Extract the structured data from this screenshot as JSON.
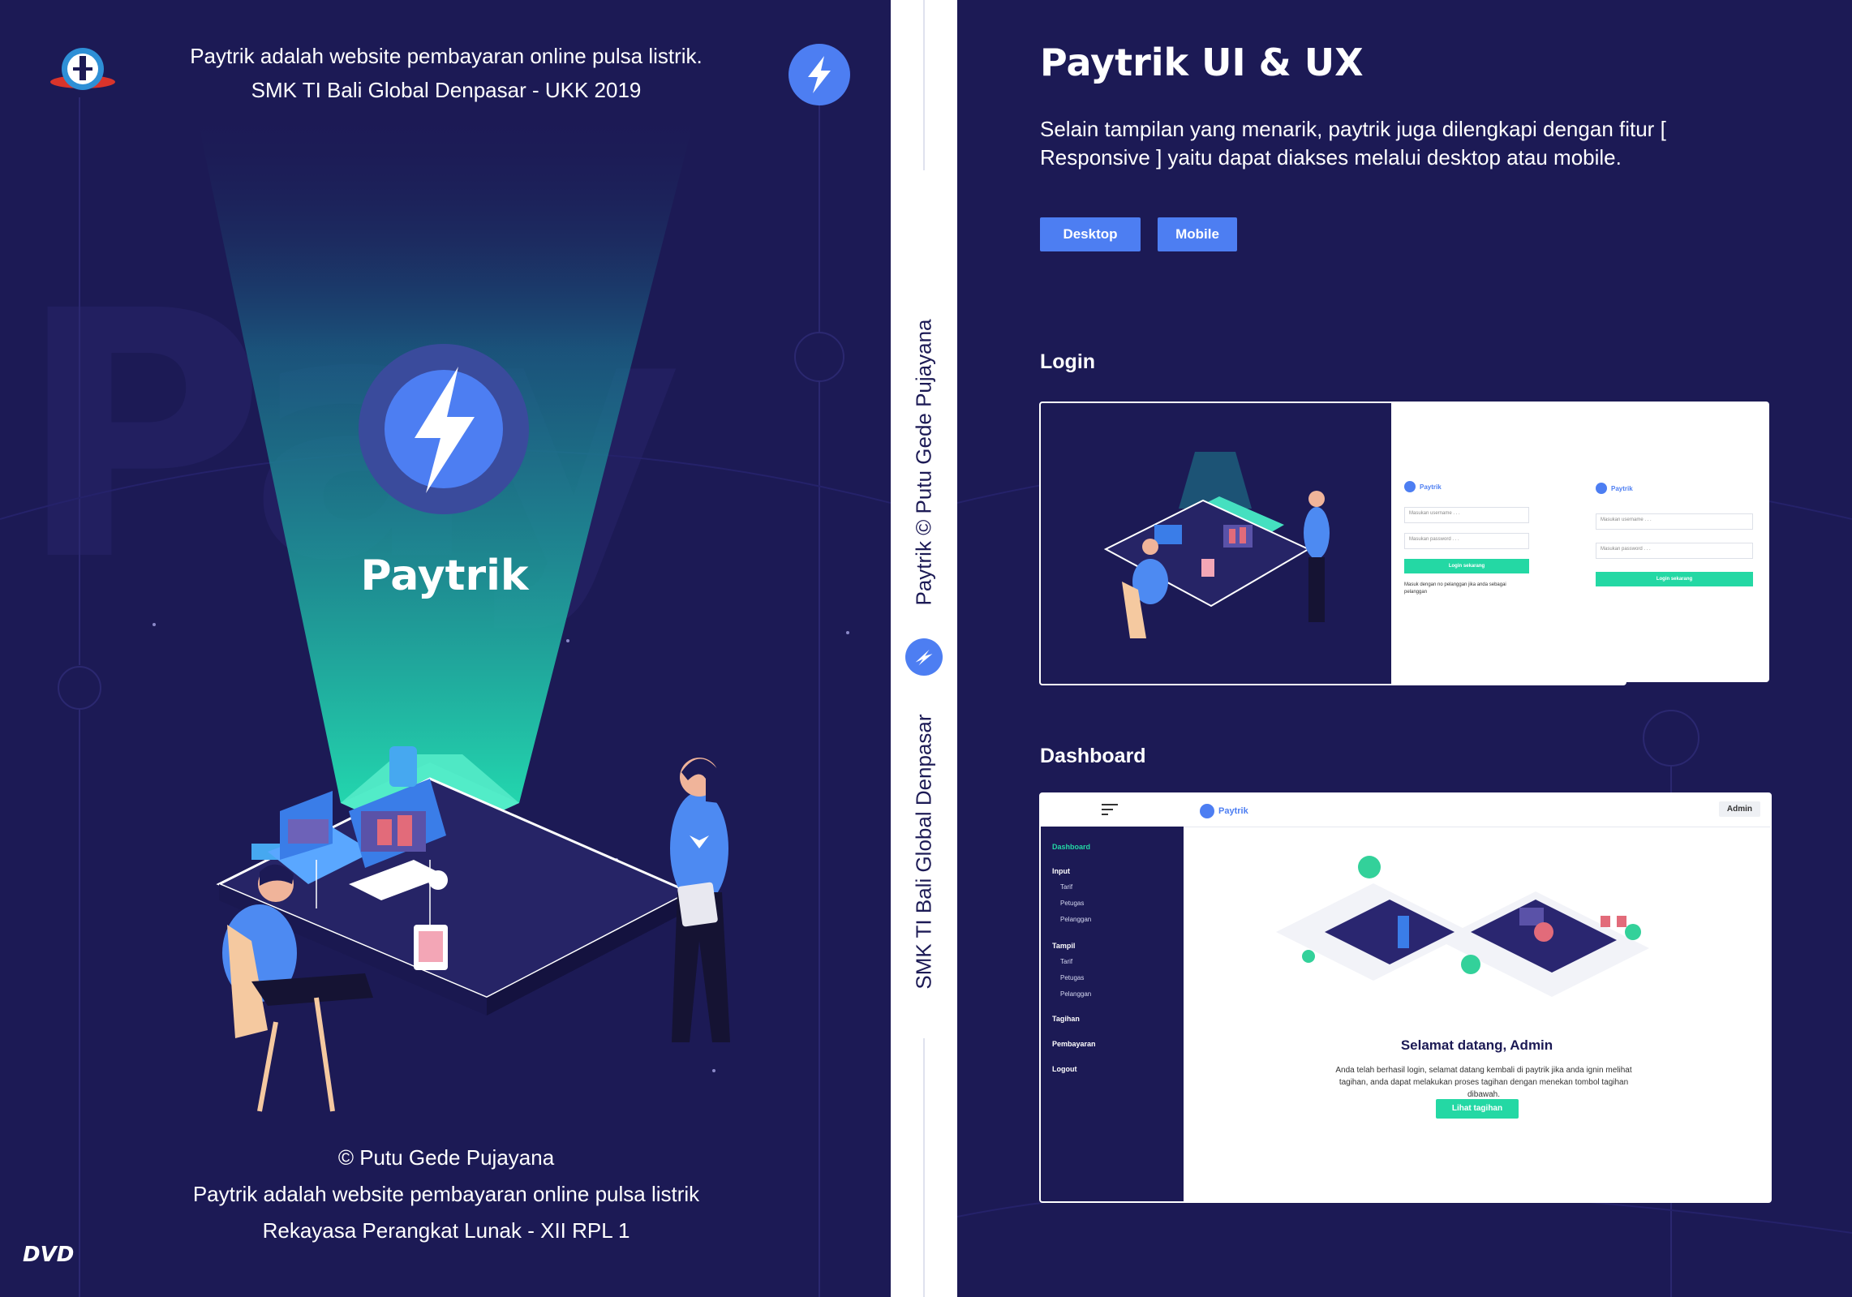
{
  "cover": {
    "top_line1": "Paytrik adalah website pembayaran online pulsa listrik.",
    "top_line2": "SMK TI Bali Global Denpasar - UKK 2019",
    "brand": "Paytrik",
    "bottom_line1": "© Putu Gede Pujayana",
    "bottom_line2": "Paytrik adalah website pembayaran online pulsa listrik",
    "bottom_line3": "Rekayasa Perangkat Lunak - XII RPL 1",
    "dvd_label": "DVD",
    "watermark": "Pay"
  },
  "spine": {
    "top_text": "Paytrik © Putu Gede Pujayana",
    "bottom_text": "SMK TI Bali Global Denpasar"
  },
  "right": {
    "title": "Paytrik UI & UX",
    "description": "Selain tampilan yang menarik, paytrik juga dilengkapi dengan fitur [ Responsive ] yaitu dapat diakses melalui desktop atau mobile.",
    "btn_desktop": "Desktop",
    "btn_mobile": "Mobile",
    "login_heading": "Login",
    "dashboard_heading": "Dashboard"
  },
  "login_preview": {
    "brand": "Paytrik",
    "username_placeholder": "Masukan username . . .",
    "password_placeholder": "Masukan password . . .",
    "login_button": "Login sekarang",
    "note": "Masuk dengan no pelanggan jika anda sebagai pelanggan"
  },
  "dashboard_preview": {
    "brand": "Paytrik",
    "admin": "Admin",
    "menu": {
      "dashboard": "Dashboard",
      "input": "Input",
      "input_items": [
        "Tarif",
        "Petugas",
        "Pelanggan"
      ],
      "tampil": "Tampil",
      "tampil_items": [
        "Tarif",
        "Petugas",
        "Pelanggan"
      ],
      "tagihan": "Tagihan",
      "pembayaran": "Pembayaran",
      "logout": "Logout"
    },
    "welcome": "Selamat datang, Admin",
    "welcome_desc": "Anda telah berhasil login, selamat datang kembali di paytrik jika anda ignin melihat tagihan, anda dapat melakukan proses tagihan dengan menekan tombol tagihan dibawah.",
    "button": "Lihat tagihan"
  },
  "colors": {
    "navy": "#1c1a55",
    "accent_blue": "#4d7ef2",
    "accent_green": "#24d8a4",
    "beam_teal": "#1fb8a4"
  },
  "icons": [
    "bolt-icon",
    "school-logo",
    "hamburger-icon",
    "dvd-logo"
  ]
}
